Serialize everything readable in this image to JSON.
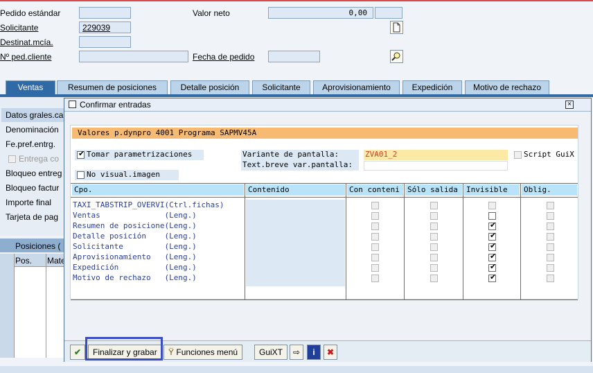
{
  "header": {
    "pedido_label": "Pedido estándar",
    "pedido_value": "",
    "valor_neto_label": "Valor neto",
    "valor_neto_value": "0,00",
    "solicitante_label": "Solicitante",
    "solicitante_value": "229039",
    "destinat_label": "Destinat.mcía.",
    "destinat_value": "",
    "ped_cliente_label": "Nº ped.cliente",
    "ped_cliente_value": "",
    "fecha_label": "Fecha de pedido",
    "fecha_value": ""
  },
  "tabs": [
    {
      "label": "Ventas"
    },
    {
      "label": "Resumen de posiciones"
    },
    {
      "label": "Detalle posición"
    },
    {
      "label": "Solicitante"
    },
    {
      "label": "Aprovisionamiento"
    },
    {
      "label": "Expedición"
    },
    {
      "label": "Motivo de rechazo"
    }
  ],
  "left_panel": {
    "rows": [
      "Datos grales.ca",
      "Denominación",
      "Fe.pref.entrg.",
      "Entrega co",
      "Bloqueo entreg",
      "Bloqueo factur",
      "Importe final",
      "Tarjeta de pag"
    ],
    "subheader": "Posiciones (",
    "grid_cols": [
      "Pos.",
      "Mate"
    ]
  },
  "dialog": {
    "title": "Confirmar entradas",
    "banner": "Valores p.dynpro 4001 Programa SAPMV45A",
    "tomar_label": "Tomar parametrizaciones",
    "no_visual_label": "No visual.imagen",
    "variante_label": "Variante de pantalla:",
    "variante_value": "ZVA01_2",
    "text_breve_label": "Text.breve var.pantalla:",
    "text_breve_value": "",
    "script_label": "Script GuiX",
    "columns": [
      "Cpo.",
      "Contenido",
      "Con conteni",
      "Sólo salida",
      "Invisible",
      "Oblig."
    ],
    "rows": [
      {
        "campo": "TAXI_TABSTRIP_OVERVI(Ctrl.fichas)",
        "invisible": false
      },
      {
        "campo": "Ventas              (Leng.)",
        "invisible": false
      },
      {
        "campo": "Resumen de posicione(Leng.)",
        "invisible": true
      },
      {
        "campo": "Detalle posición    (Leng.)",
        "invisible": true
      },
      {
        "campo": "Solicitante         (Leng.)",
        "invisible": true
      },
      {
        "campo": "Aprovisionamiento   (Leng.)",
        "invisible": true
      },
      {
        "campo": "Expedición          (Leng.)",
        "invisible": true
      },
      {
        "campo": "Motivo de rechazo   (Leng.)",
        "invisible": true
      }
    ],
    "footer": {
      "finalizar": "Finalizar y grabar",
      "funciones": "Funciones menú",
      "guixt": "GuiXT"
    }
  },
  "colors": {
    "accent_blue": "#2f6aa7",
    "banner_orange": "#f7ba73",
    "column_header": "#b8e3f8",
    "highlight": "#3b4bc4"
  }
}
